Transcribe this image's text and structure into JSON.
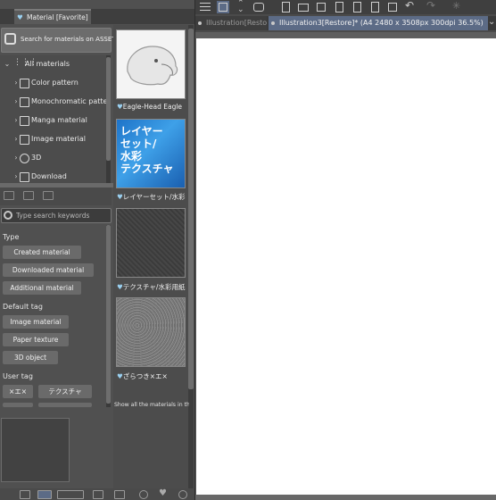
{
  "material_panel": {
    "tab_title": "Material [Favorite]",
    "assets_button_label": "Search for materials on ASSETS",
    "tree": [
      {
        "label": "All materials",
        "icon": "grid-icon"
      },
      {
        "label": "Color pattern",
        "icon": "color-pattern-icon"
      },
      {
        "label": "Monochromatic pattern",
        "icon": "mono-pattern-icon"
      },
      {
        "label": "Manga material",
        "icon": "manga-icon"
      },
      {
        "label": "Image material",
        "icon": "image-icon"
      },
      {
        "label": "3D",
        "icon": "3d-icon"
      },
      {
        "label": "Download",
        "icon": "download-icon"
      }
    ],
    "search_placeholder": "Type search keywords",
    "sections": {
      "type_label": "Type",
      "type_tags": [
        "Created material",
        "Downloaded material",
        "Additional material"
      ],
      "default_tag_label": "Default tag",
      "default_tags": [
        "Image material",
        "Paper texture",
        "3D object"
      ],
      "user_tag_label": "User tag",
      "user_tags": [
        "×エ×",
        "テクスチャ"
      ]
    },
    "thumbnails": [
      {
        "label": "Eagle-Head Eagle"
      },
      {
        "label": "レイヤーセット/水彩",
        "image_text": [
          "レイヤー",
          "セット/",
          "水彩",
          "テクスチャ"
        ]
      },
      {
        "label": "テクスチャ/水彩用紙"
      },
      {
        "label": "ざらつき×エ×"
      }
    ],
    "show_all_text": "Show all the materials in the"
  },
  "document_tabs": [
    {
      "label": "Illustration[Restore]",
      "active": false
    },
    {
      "label": "Illustration3[Restore]* (A4 2480 x 3508px 300dpi 36.5%)",
      "active": true
    }
  ],
  "colors": {
    "accent_heart": "#9ad0f0",
    "active_tab": "#5c6b86",
    "paper": "#ffffff"
  }
}
